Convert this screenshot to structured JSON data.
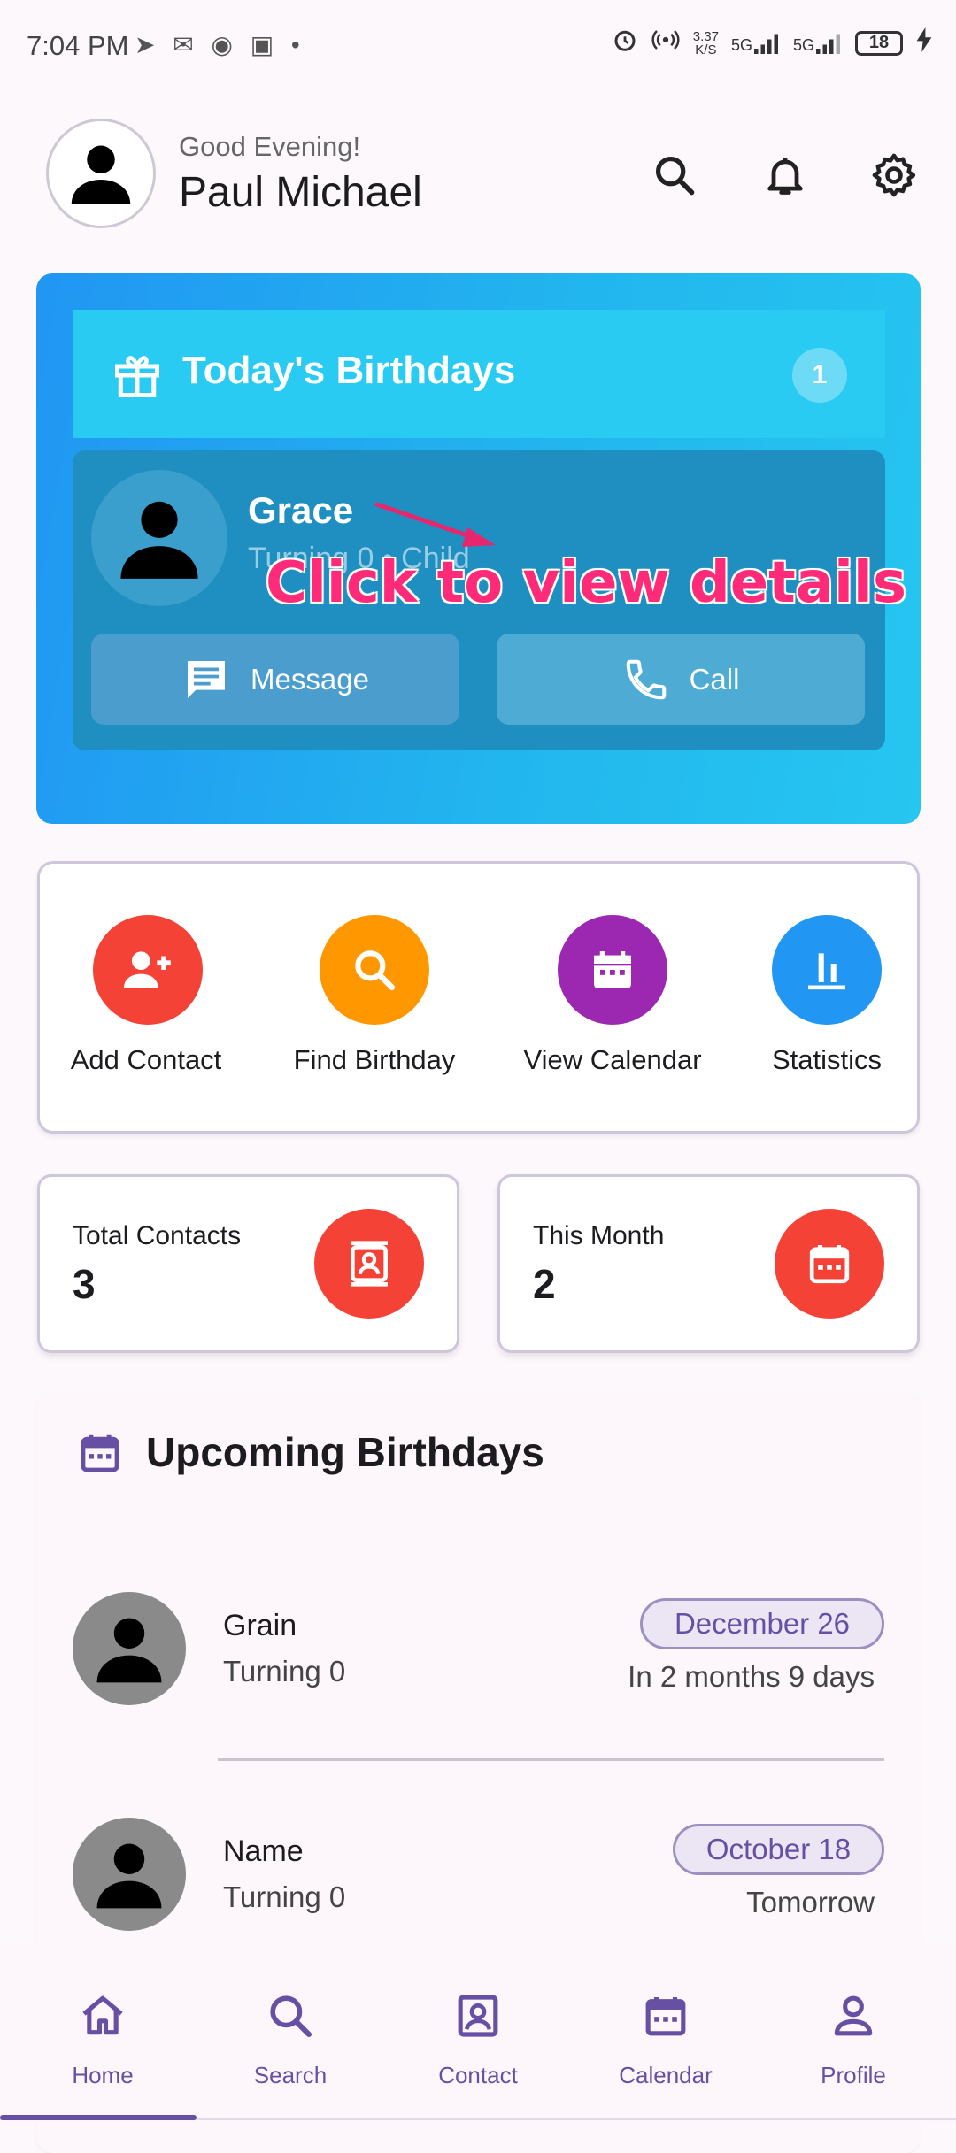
{
  "status_bar": {
    "time": "7:04 PM",
    "left_icons": "➤ ✉ ◉ ▣ •",
    "net_speed_top": "3.37",
    "net_speed_bottom": "K/S",
    "signal1": "5G",
    "signal2": "5G",
    "battery": "18"
  },
  "header": {
    "greeting": "Good Evening!",
    "user_name": "Paul Michael"
  },
  "todays_birthdays": {
    "title": "Today's Birthdays",
    "count": "1",
    "person": {
      "name": "Grace",
      "subtitle": "Turning 0 • Child"
    },
    "message_label": "Message",
    "call_label": "Call",
    "overlay_hint": "Click to view details"
  },
  "quick_actions": [
    {
      "label": "Add Contact",
      "color": "#f44336",
      "icon": "add-person-icon"
    },
    {
      "label": "Find Birthday",
      "color": "#ff9800",
      "icon": "search-icon"
    },
    {
      "label": "View Calendar",
      "color": "#9c27b0",
      "icon": "calendar-icon"
    },
    {
      "label": "Statistics",
      "color": "#2196f3",
      "icon": "bar-chart-icon"
    }
  ],
  "stats": {
    "total_contacts_label": "Total Contacts",
    "total_contacts_value": "3",
    "this_month_label": "This Month",
    "this_month_value": "2"
  },
  "upcoming": {
    "title": "Upcoming Birthdays",
    "items": [
      {
        "name": "Grain",
        "subtitle": "Turning 0",
        "date": "December 26",
        "until": "In 2 months 9 days"
      },
      {
        "name": "Name",
        "subtitle": "Turning 0",
        "date": "October 18",
        "until": "Tomorrow"
      }
    ]
  },
  "bottom_nav": [
    {
      "label": "Home",
      "icon": "home-icon",
      "active": true
    },
    {
      "label": "Search",
      "icon": "search-icon"
    },
    {
      "label": "Contact",
      "icon": "contact-icon"
    },
    {
      "label": "Calendar",
      "icon": "calendar-icon"
    },
    {
      "label": "Profile",
      "icon": "profile-icon"
    }
  ],
  "colors": {
    "accent": "#6750a4",
    "card_gradient_start": "#2196f3",
    "card_gradient_end": "#26c6f0",
    "overlay": "#ff2a78"
  }
}
